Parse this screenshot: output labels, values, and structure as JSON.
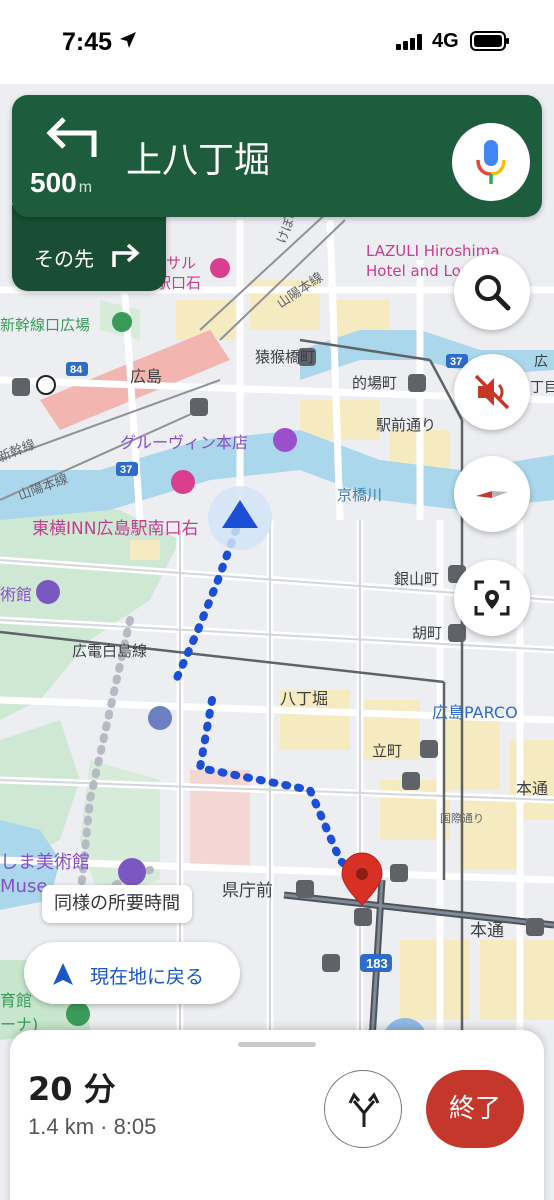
{
  "status_bar": {
    "time": "7:45",
    "network": "4G"
  },
  "navigation": {
    "turn_icon": "turn-left-icon",
    "distance_value": "500",
    "distance_unit": "m",
    "street": "上八丁堀",
    "then_label": "その先",
    "then_icon": "turn-right-icon"
  },
  "map_labels": {
    "mihashi": "けぼの通り",
    "sanyo_main": "山陽本線",
    "sanyo_main_2": "山陽本線",
    "shinkansen_gate": "新幹線口広場",
    "hiroshima_station": "広島",
    "shinkansen": "新幹線",
    "lazuli_1": "LAZULI Hiroshima",
    "lazuli_2": "Hotel and Lou",
    "hotel_partial_1": "サル",
    "hotel_partial_2": "駅口石",
    "enkobashi": "猿猴橋町",
    "matoba": "的場町",
    "ekimae_dori": "駅前通り",
    "greenvin": "グルーヴィン本店",
    "kyobashi": "京橋川",
    "toyoko": "東横INN広島駅南口右",
    "ginzan": "銀山町",
    "kanayama": "胡町",
    "hiroden": "広電白島線",
    "hatchobori": "八丁堀",
    "parco": "広島PARCO",
    "tatemachi": "立町",
    "hondori": "本通",
    "hondori_2": "本通",
    "kokusai": "国際通り",
    "kenchomae": "県庁前",
    "museum_1": "しま美術館",
    "museum_2": "Muse",
    "kanpatial": "術館",
    "hiroshima_ji_1": "育館",
    "hiroshima_ji_2": "ーナ)",
    "route_183": "183",
    "route_37": "37",
    "route_37b": "37",
    "route_84": "84",
    "hiroshima_r": "広",
    "hiroshima_r2": "丁目"
  },
  "buttons": {
    "search_icon": "search-icon",
    "mute_icon": "volume-off-icon",
    "compass_icon": "compass-icon",
    "report_icon": "report-location-icon",
    "same_time_label": "同様の所要時間",
    "recenter_label": "現在地に戻る"
  },
  "trip": {
    "duration": "20 分",
    "details": "1.4 km · 8:05",
    "alt_routes_icon": "alternate-routes-icon",
    "exit_label": "終了"
  },
  "colors": {
    "nav_green": "#1d5c3c",
    "route_blue": "#1a4fd6",
    "exit_red": "#c5372b",
    "destination_red": "#d93025"
  }
}
